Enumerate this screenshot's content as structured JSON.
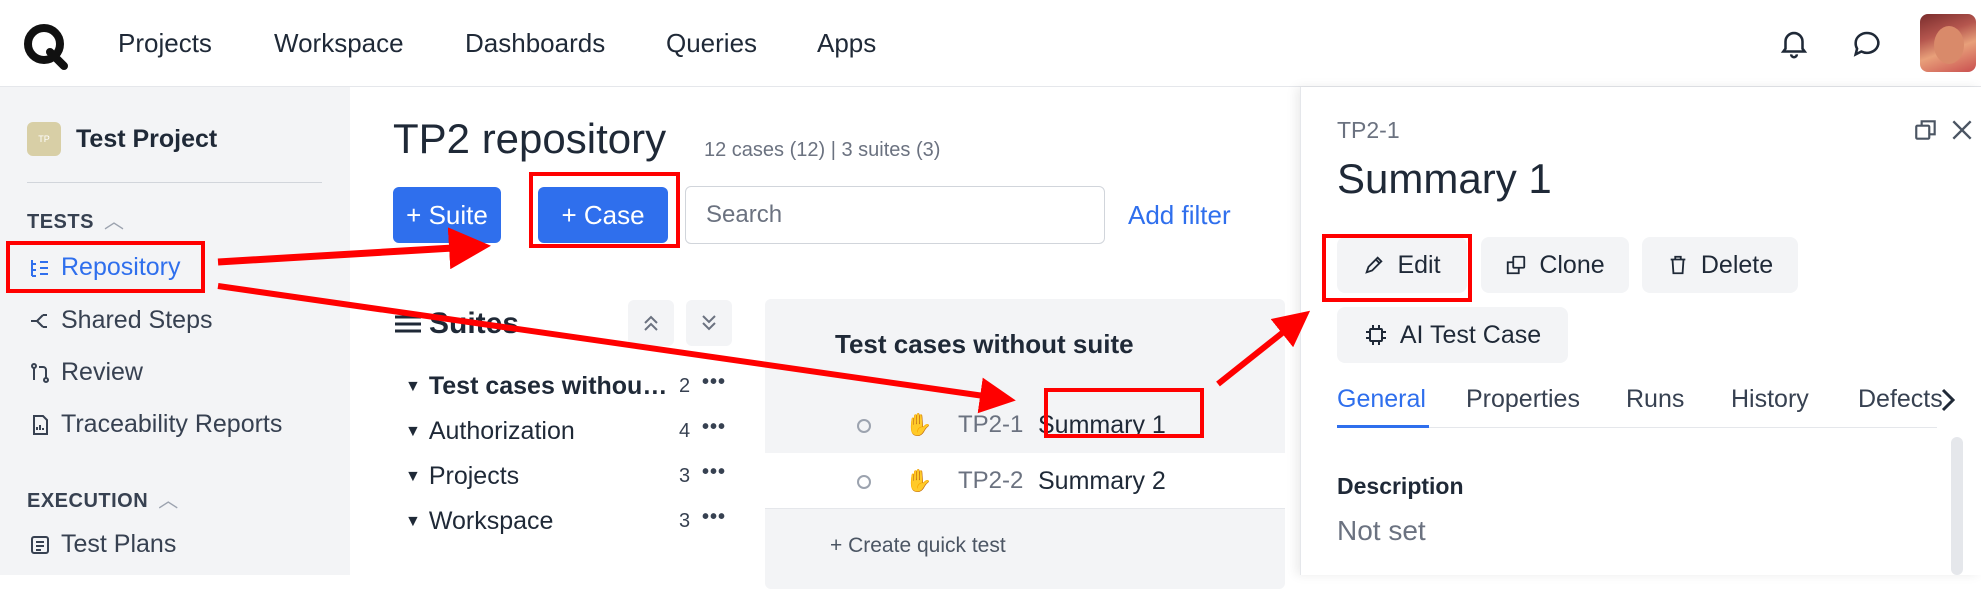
{
  "topbar": {
    "nav": [
      "Projects",
      "Workspace",
      "Dashboards",
      "Queries",
      "Apps"
    ],
    "icons": [
      "bell-icon",
      "chat-icon"
    ]
  },
  "sidebar": {
    "project_badge": "TP",
    "project_name": "Test Project",
    "tests_heading": "TESTS",
    "tests_items": [
      "Repository",
      "Shared Steps",
      "Review",
      "Traceability Reports"
    ],
    "execution_heading": "EXECUTION",
    "execution_items": [
      "Test Plans"
    ]
  },
  "main": {
    "title": "TP2 repository",
    "meta": "12 cases (12) | 3 suites (3)",
    "suite_button": "+ Suite",
    "case_button": "+ Case",
    "search_placeholder": "Search",
    "add_filter": "Add filter",
    "suites_title": "Suites",
    "suites": [
      {
        "name": "Test cases withou…",
        "count": "2",
        "bold": true
      },
      {
        "name": "Authorization",
        "count": "4"
      },
      {
        "name": "Projects",
        "count": "3"
      },
      {
        "name": "Workspace",
        "count": "3"
      }
    ],
    "case_group_title": "Test cases without suite",
    "cases": [
      {
        "id": "TP2-1",
        "summary": "Summary 1"
      },
      {
        "id": "TP2-2",
        "summary": "Summary 2"
      }
    ],
    "create_quick_test": "+ Create quick test"
  },
  "detail": {
    "id": "TP2-1",
    "title": "Summary 1",
    "edit": "Edit",
    "clone": "Clone",
    "delete": "Delete",
    "ai_test_case": "AI Test Case",
    "tabs": [
      "General",
      "Properties",
      "Runs",
      "History",
      "Defects"
    ],
    "active_tab": "General",
    "description_label": "Description",
    "description_value": "Not set"
  },
  "colors": {
    "accent": "#2f6fed",
    "highlight": "#ff0000"
  }
}
